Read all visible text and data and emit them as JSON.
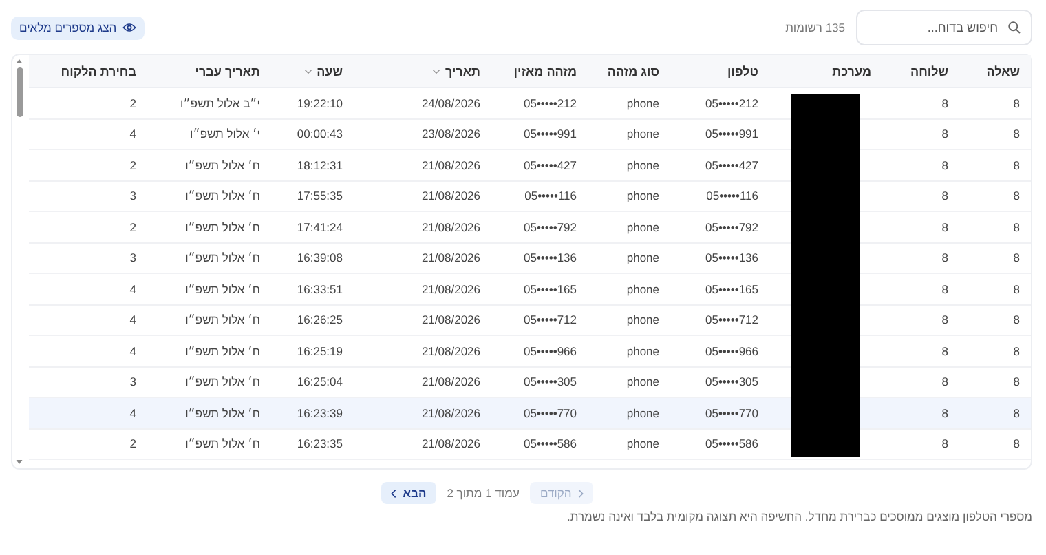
{
  "toolbar": {
    "search": {
      "placeholder": "חיפוש בדוח..."
    },
    "record_count": "135 רשומות",
    "show_full_button": "הצג מספרים מלאים"
  },
  "table": {
    "columns": [
      {
        "label": "שאלה",
        "sortable": false
      },
      {
        "label": "שלוחה",
        "sortable": false
      },
      {
        "label": "מערכת",
        "sortable": false
      },
      {
        "label": "טלפון",
        "sortable": false
      },
      {
        "label": "סוג מזהה",
        "sortable": false
      },
      {
        "label": "מזהה מאזין",
        "sortable": false
      },
      {
        "label": "תאריך",
        "sortable": true
      },
      {
        "label": "שעה",
        "sortable": true
      },
      {
        "label": "תאריך עברי",
        "sortable": false
      },
      {
        "label": "בחירת הלקוח",
        "sortable": false
      }
    ],
    "system_redacted": true,
    "rows": [
      {
        "selected": false,
        "cells": [
          "8",
          "8",
          "",
          "05•••••212",
          "phone",
          "05•••••212",
          "24/08/2026",
          "19:22:10",
          "י״ב אלול תשפ״ו",
          "2"
        ]
      },
      {
        "selected": false,
        "cells": [
          "8",
          "8",
          "",
          "05•••••991",
          "phone",
          "05•••••991",
          "23/08/2026",
          "00:00:43",
          "י׳ אלול תשפ״ו",
          "4"
        ]
      },
      {
        "selected": false,
        "cells": [
          "8",
          "8",
          "",
          "05•••••427",
          "phone",
          "05•••••427",
          "21/08/2026",
          "18:12:31",
          "ח׳ אלול תשפ״ו",
          "2"
        ]
      },
      {
        "selected": false,
        "cells": [
          "8",
          "8",
          "",
          "05•••••116",
          "phone",
          "05•••••116",
          "21/08/2026",
          "17:55:35",
          "ח׳ אלול תשפ״ו",
          "3"
        ]
      },
      {
        "selected": false,
        "cells": [
          "8",
          "8",
          "",
          "05•••••792",
          "phone",
          "05•••••792",
          "21/08/2026",
          "17:41:24",
          "ח׳ אלול תשפ״ו",
          "2"
        ]
      },
      {
        "selected": false,
        "cells": [
          "8",
          "8",
          "",
          "05•••••136",
          "phone",
          "05•••••136",
          "21/08/2026",
          "16:39:08",
          "ח׳ אלול תשפ״ו",
          "3"
        ]
      },
      {
        "selected": false,
        "cells": [
          "8",
          "8",
          "",
          "05•••••165",
          "phone",
          "05•••••165",
          "21/08/2026",
          "16:33:51",
          "ח׳ אלול תשפ״ו",
          "4"
        ]
      },
      {
        "selected": false,
        "cells": [
          "8",
          "8",
          "",
          "05•••••712",
          "phone",
          "05•••••712",
          "21/08/2026",
          "16:26:25",
          "ח׳ אלול תשפ״ו",
          "4"
        ]
      },
      {
        "selected": false,
        "cells": [
          "8",
          "8",
          "",
          "05•••••966",
          "phone",
          "05•••••966",
          "21/08/2026",
          "16:25:19",
          "ח׳ אלול תשפ״ו",
          "4"
        ]
      },
      {
        "selected": false,
        "cells": [
          "8",
          "8",
          "",
          "05•••••305",
          "phone",
          "05•••••305",
          "21/08/2026",
          "16:25:04",
          "ח׳ אלול תשפ״ו",
          "3"
        ]
      },
      {
        "selected": true,
        "cells": [
          "8",
          "8",
          "",
          "05•••••770",
          "phone",
          "05•••••770",
          "21/08/2026",
          "16:23:39",
          "ח׳ אלול תשפ״ו",
          "4"
        ]
      },
      {
        "selected": false,
        "cells": [
          "8",
          "8",
          "",
          "05•••••586",
          "phone",
          "05•••••586",
          "21/08/2026",
          "16:23:35",
          "ח׳ אלול תשפ״ו",
          "2"
        ]
      }
    ]
  },
  "pagination": {
    "previous": {
      "label": "הקודם",
      "disabled": true
    },
    "page_info": "עמוד 1 מתוך 2",
    "next": {
      "label": "הבא",
      "disabled": false
    }
  },
  "footer_note": "מספרי הטלפון מוצגים ממוסכים כברירת מחדל. החשיפה היא תצוגה מקומית בלבד ואינה נשמרת."
}
